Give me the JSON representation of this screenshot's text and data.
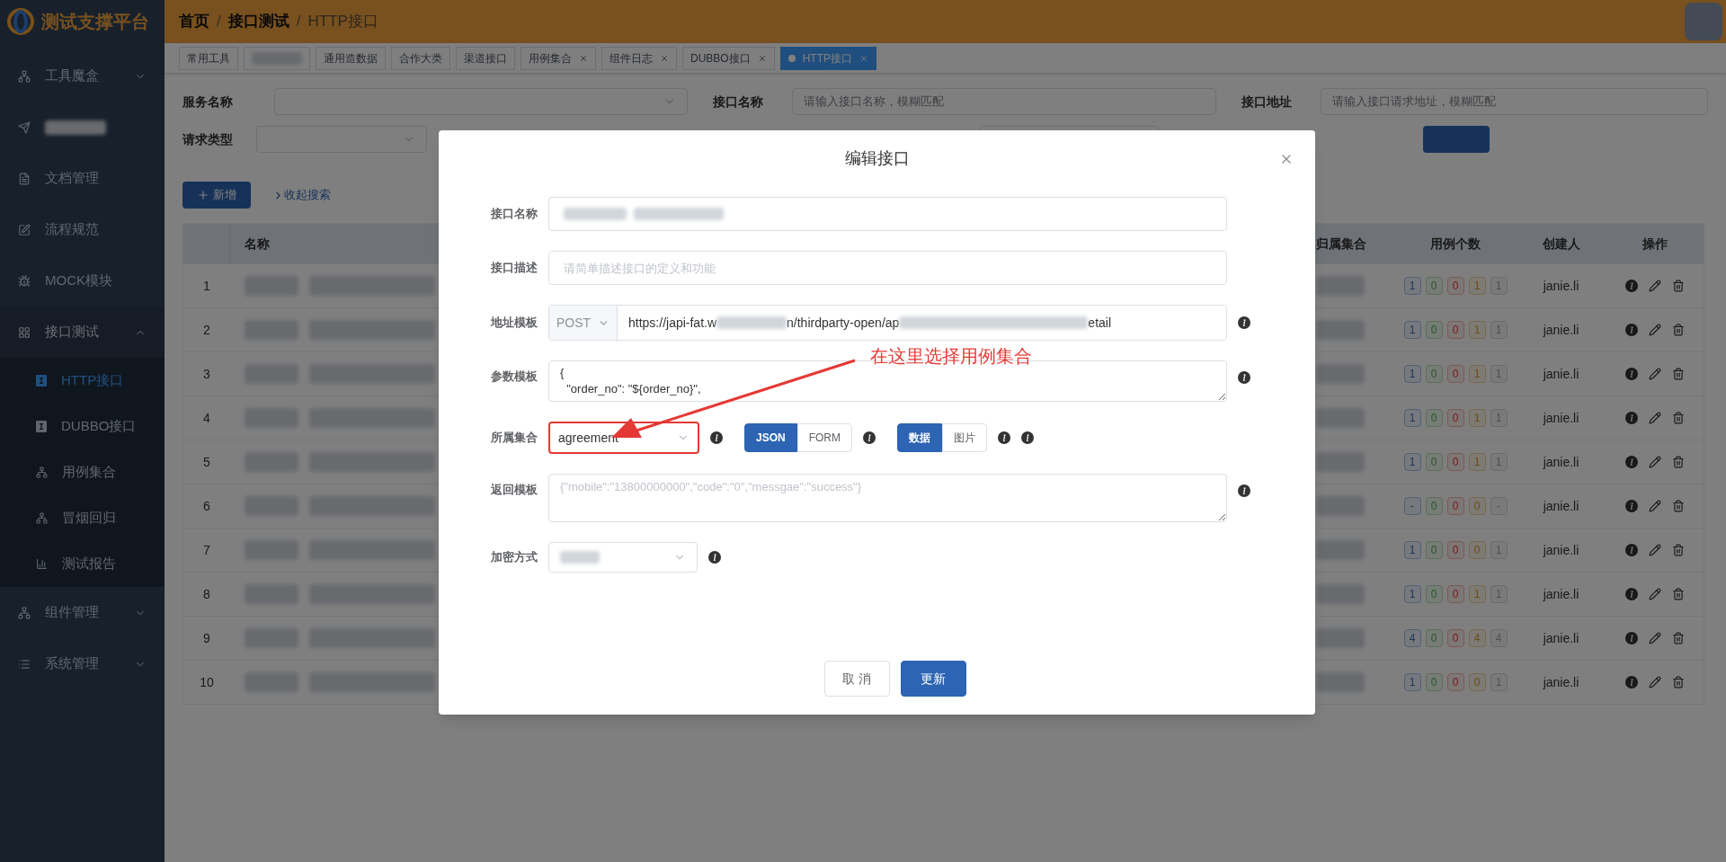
{
  "header": {
    "logo_text": "测试支撑平台",
    "breadcrumb_separator": "/",
    "breadcrumb": [
      {
        "label": "首页",
        "current": false
      },
      {
        "label": "接口测试",
        "current": false
      },
      {
        "label": "HTTP接口",
        "current": true
      }
    ]
  },
  "sidebar": {
    "items": [
      {
        "kind": "menu",
        "label": "工具魔盒",
        "expanded": false
      },
      {
        "kind": "redacted"
      },
      {
        "kind": "menu",
        "label": "文档管理"
      },
      {
        "kind": "menu",
        "label": "流程规范"
      },
      {
        "kind": "menu",
        "label": "MOCK模块"
      },
      {
        "kind": "menu",
        "label": "接口测试",
        "expanded": true,
        "children": [
          {
            "label": "HTTP接口",
            "selected": true
          },
          {
            "label": "DUBBO接口",
            "selected": false
          },
          {
            "label": "用例集合",
            "selected": false
          },
          {
            "label": "冒烟回归",
            "selected": false
          },
          {
            "label": "测试报告",
            "selected": false
          }
        ]
      },
      {
        "kind": "menu",
        "label": "组件管理",
        "expanded": false
      },
      {
        "kind": "menu",
        "label": "系统管理",
        "expanded": false
      }
    ]
  },
  "tabs": [
    {
      "kind": "text",
      "label": "常用工具",
      "closable": false,
      "selected": false
    },
    {
      "kind": "redacted",
      "closable": false,
      "selected": false
    },
    {
      "kind": "text",
      "label": "通用造数据",
      "closable": false,
      "selected": false
    },
    {
      "kind": "text",
      "label": "合作大类",
      "closable": false,
      "selected": false
    },
    {
      "kind": "text",
      "label": "渠道接口",
      "closable": false,
      "selected": false
    },
    {
      "kind": "text",
      "label": "用例集合",
      "closable": true,
      "selected": false
    },
    {
      "kind": "text",
      "label": "组件日志",
      "closable": true,
      "selected": false
    },
    {
      "kind": "text",
      "label": "DUBBO接口",
      "closable": true,
      "selected": false
    },
    {
      "kind": "text",
      "label": "HTTP接口",
      "closable": true,
      "selected": true
    }
  ],
  "filters": {
    "service_label": "服务名称",
    "name_label": "接口名称",
    "name_placeholder": "请输入接口名称，模糊匹配",
    "address_label": "接口地址",
    "address_placeholder": "请输入接口请求地址，模糊匹配",
    "type_label": "请求类型"
  },
  "actions": {
    "add": "新增",
    "collapse": "收起搜索"
  },
  "table": {
    "columns": [
      "名称",
      "归属集合",
      "用例个数",
      "创建人",
      "操作"
    ],
    "rows": [
      {
        "index": "1",
        "counts": [
          "1",
          "0",
          "0",
          "1",
          "1"
        ],
        "creator": "janie.li"
      },
      {
        "index": "2",
        "counts": [
          "1",
          "0",
          "0",
          "1",
          "1"
        ],
        "creator": "janie.li"
      },
      {
        "index": "3",
        "counts": [
          "1",
          "0",
          "0",
          "1",
          "1"
        ],
        "creator": "janie.li"
      },
      {
        "index": "4",
        "counts": [
          "1",
          "0",
          "0",
          "1",
          "1"
        ],
        "creator": "janie.li"
      },
      {
        "index": "5",
        "counts": [
          "1",
          "0",
          "0",
          "1",
          "1"
        ],
        "creator": "janie.li"
      },
      {
        "index": "6",
        "counts": [
          "-",
          "0",
          "0",
          "0",
          "-"
        ],
        "creator": "janie.li"
      },
      {
        "index": "7",
        "counts": [
          "1",
          "0",
          "0",
          "0",
          "1"
        ],
        "creator": "janie.li"
      },
      {
        "index": "8",
        "counts": [
          "1",
          "0",
          "0",
          "1",
          "1"
        ],
        "creator": "janie.li"
      },
      {
        "index": "9",
        "counts": [
          "4",
          "0",
          "0",
          "4",
          "4"
        ],
        "creator": "janie.li"
      },
      {
        "index": "10",
        "counts": [
          "1",
          "0",
          "0",
          "0",
          "1"
        ],
        "creator": "janie.li"
      }
    ]
  },
  "modal": {
    "title": "编辑接口",
    "name_label": "接口名称",
    "desc_label": "接口描述",
    "desc_placeholder": "请简单描述接口的定义和功能",
    "address_label": "地址模板",
    "method": "POST",
    "url_parts": [
      "https://japi-fat.w",
      "n/thirdparty-open/ap",
      "etail"
    ],
    "params_label": "参数模板",
    "params_lines": [
      "{",
      "  \"order_no\": \"${order_no}\","
    ],
    "group_label": "所属集合",
    "group_value": "agreement",
    "format_toggle": [
      {
        "label": "JSON",
        "selected": true
      },
      {
        "label": "FORM",
        "selected": false
      }
    ],
    "data_toggle": [
      {
        "label": "数据",
        "selected": true
      },
      {
        "label": "图片",
        "selected": false
      }
    ],
    "return_label": "返回模板",
    "return_placeholder": "{\"mobile\":\"13800000000\",\"code\":\"0\",\"messgae\":\"success\"}",
    "encrypt_label": "加密方式",
    "buttons": [
      {
        "kind": "default",
        "label": "取 消"
      },
      {
        "kind": "primary",
        "label": "更新"
      }
    ]
  },
  "annotation": {
    "text": "在这里选择用例集合"
  }
}
